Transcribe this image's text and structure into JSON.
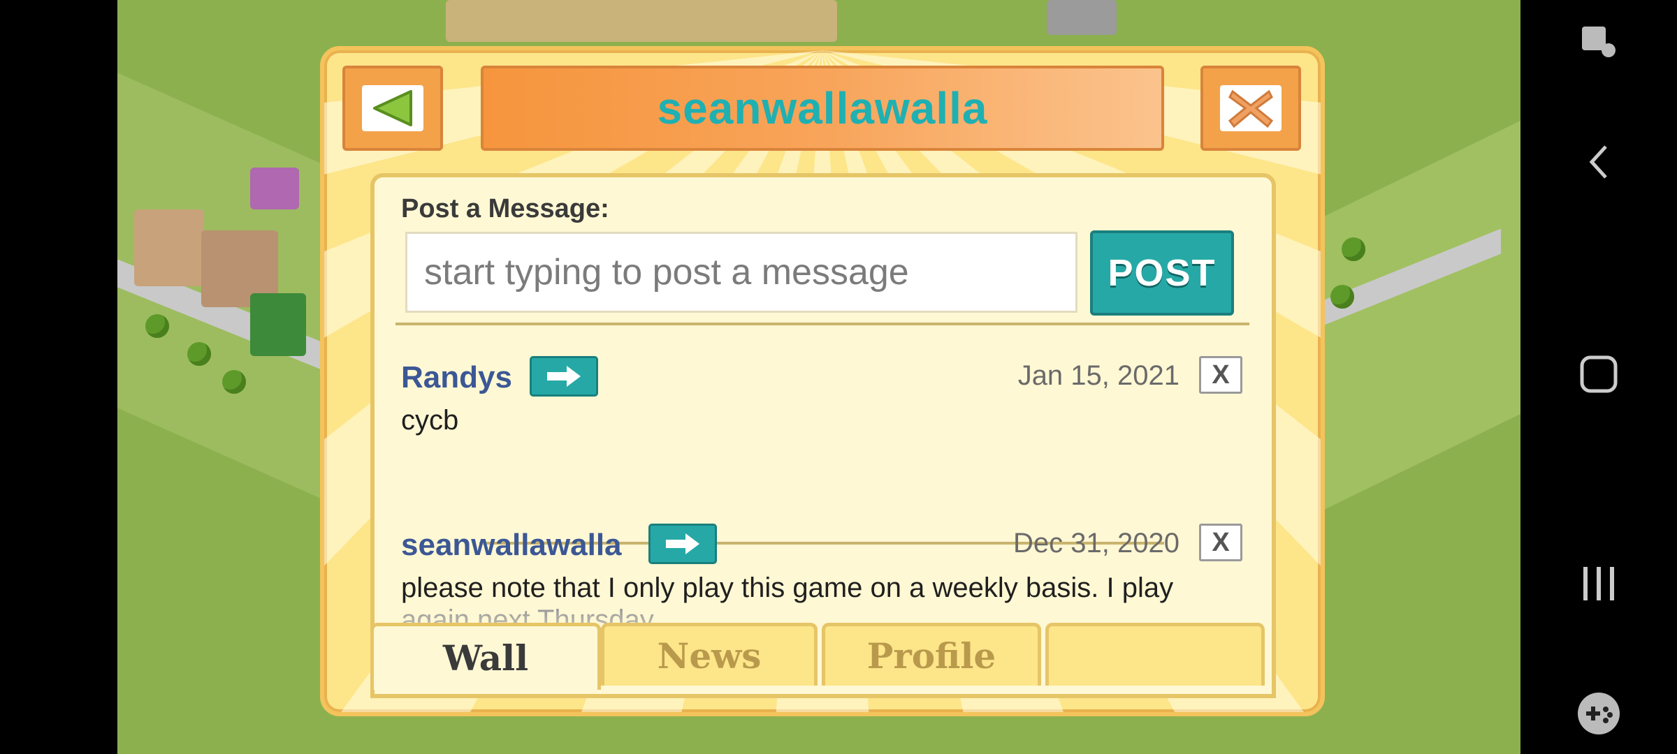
{
  "dialog": {
    "title": "seanwallawalla",
    "post_label": "Post a Message:",
    "input_placeholder": "start typing to post a message",
    "input_value": "",
    "post_button": "POST"
  },
  "posts": [
    {
      "author": "Randys",
      "date": "Jan 15, 2021",
      "text": "cycb",
      "delete": "X"
    },
    {
      "author": "seanwallawalla",
      "date": "Dec 31, 2020",
      "text": "please note that I only play this game on a weekly basis. I play",
      "text_more": "again next Thursday",
      "delete": "X"
    }
  ],
  "tabs": [
    {
      "label": "Wall",
      "active": true
    },
    {
      "label": "News",
      "active": false
    },
    {
      "label": "Profile",
      "active": false
    },
    {
      "label": "",
      "active": false
    }
  ],
  "colors": {
    "accent_teal": "#26a9a6",
    "title_teal": "#1fb0b2",
    "author_blue": "#3b5795",
    "panel_yellow": "#fde58a",
    "game_green": "#8db04f"
  },
  "icons": {
    "back": "triangle-left-icon",
    "close": "close-x-icon",
    "arrow": "arrow-right-icon",
    "nav_back": "chevron-left-icon",
    "nav_home": "square-home-icon",
    "nav_recent": "recent-apps-icon",
    "top_right": "screen-touch-icon",
    "game": "gamepad-icon"
  }
}
